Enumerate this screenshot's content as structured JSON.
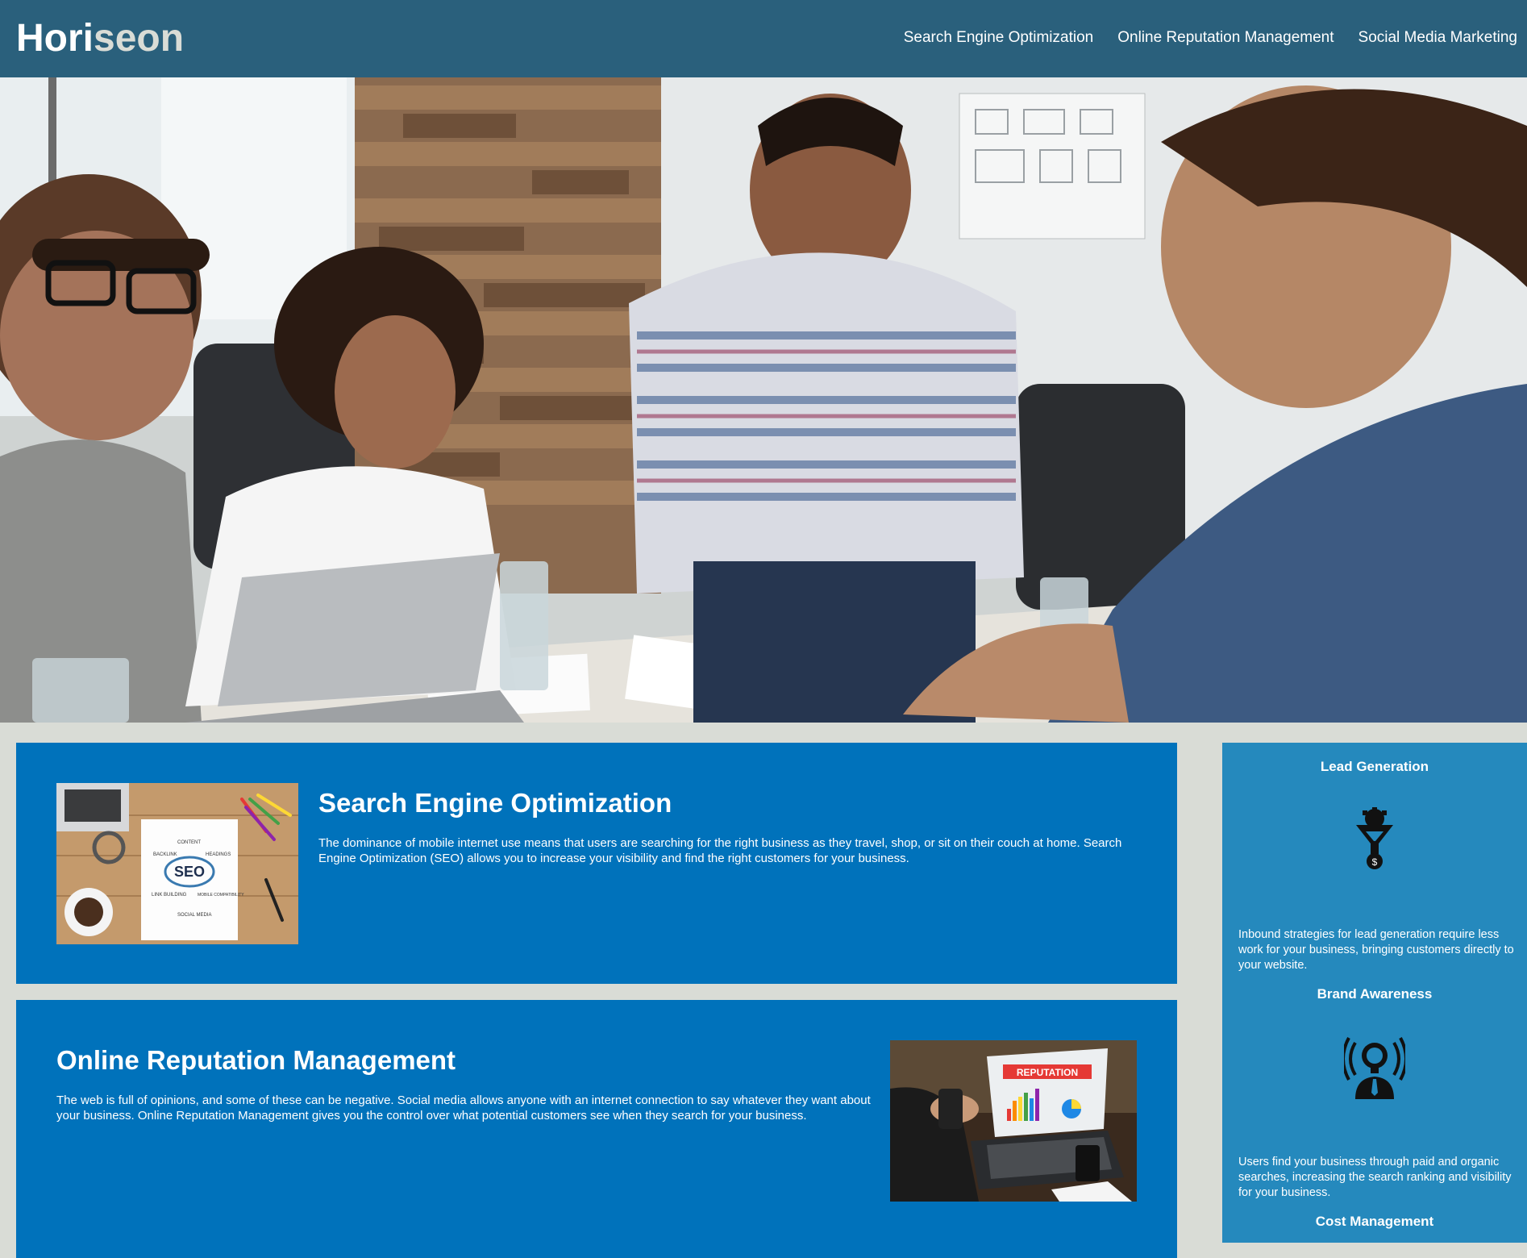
{
  "header": {
    "logo_main": "Hori",
    "logo_accent": "seon",
    "nav": [
      {
        "label": "Search Engine Optimization"
      },
      {
        "label": "Online Reputation Management"
      },
      {
        "label": "Social Media Marketing"
      }
    ]
  },
  "hero": {
    "image": "team-meeting-photo"
  },
  "content": [
    {
      "title": "Search Engine Optimization",
      "text": "The dominance of mobile internet use means that users are searching for the right business as they travel, shop, or sit on their couch at home. Search Engine Optimization (SEO) allows you to increase your visibility and find the right customers for your business.",
      "image": "seo-notebook-image",
      "image_words": [
        "SEO",
        "CONTENT",
        "BACKLINK",
        "HEADINGS",
        "LINK BUILDING",
        "MOBILE COMPATIBILITY",
        "SOCIAL MEDIA"
      ]
    },
    {
      "title": "Online Reputation Management",
      "text": "The web is full of opinions, and some of these can be negative. Social media allows anyone with an internet connection to say whatever they want about your business. Online Reputation Management gives you the control over what potential customers see when they search for your business.",
      "image": "reputation-laptop-image",
      "image_words": [
        "REPUTATION"
      ]
    }
  ],
  "aside": [
    {
      "title": "Lead Generation",
      "icon": "funnel-gear-icon",
      "text": "Inbound strategies for lead generation require less work for your business, bringing customers directly to your website."
    },
    {
      "title": "Brand Awareness",
      "icon": "lightbulb-person-icon",
      "text": "Users find your business through paid and organic searches, increasing the search ranking and visibility for your business."
    },
    {
      "title": "Cost Management",
      "icon": "cost-icon",
      "text": ""
    }
  ],
  "colors": {
    "header_bg": "#2a607c",
    "page_bg": "#d9dcd6",
    "content_bg": "#0072bb",
    "aside_bg": "#2589bd",
    "logo_accent": "#d9dcd6"
  }
}
